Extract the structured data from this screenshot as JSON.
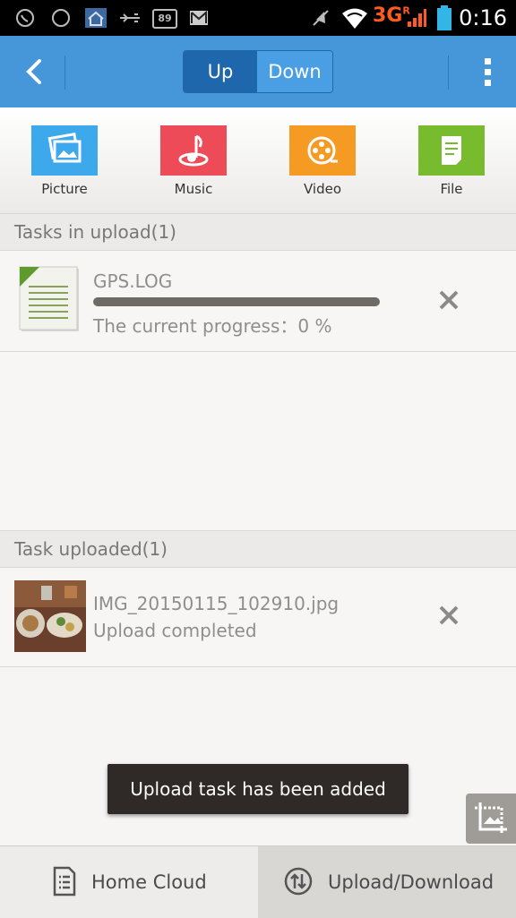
{
  "status_bar": {
    "time": "0:16",
    "network": "3G",
    "network_sub": "R",
    "battery_badge": "89"
  },
  "app_bar": {
    "segments": [
      "Up",
      "Down"
    ],
    "selected_segment": "Up"
  },
  "categories": [
    {
      "label": "Picture",
      "color": "#3ea8ec",
      "icon": "picture-icon"
    },
    {
      "label": "Music",
      "color": "#ee4b58",
      "icon": "music-icon"
    },
    {
      "label": "Video",
      "color": "#f59a23",
      "icon": "video-icon"
    },
    {
      "label": "File",
      "color": "#79bb2f",
      "icon": "file-icon"
    }
  ],
  "uploading": {
    "header": "Tasks in upload(1)",
    "items": [
      {
        "name": "GPS.LOG",
        "progress_text": "The current progress：0 %",
        "progress": 0,
        "icon": "document-icon"
      }
    ]
  },
  "uploaded": {
    "header": "Task uploaded(1)",
    "items": [
      {
        "name": "IMG_20150115_102910.jpg",
        "status": "Upload completed",
        "icon": "photo-thumbnail"
      }
    ]
  },
  "toast": "Upload task has been added",
  "tabs": [
    {
      "label": "Home Cloud",
      "icon": "document-list-icon",
      "selected": false
    },
    {
      "label": "Upload/Download",
      "icon": "transfer-icon",
      "selected": true
    }
  ]
}
